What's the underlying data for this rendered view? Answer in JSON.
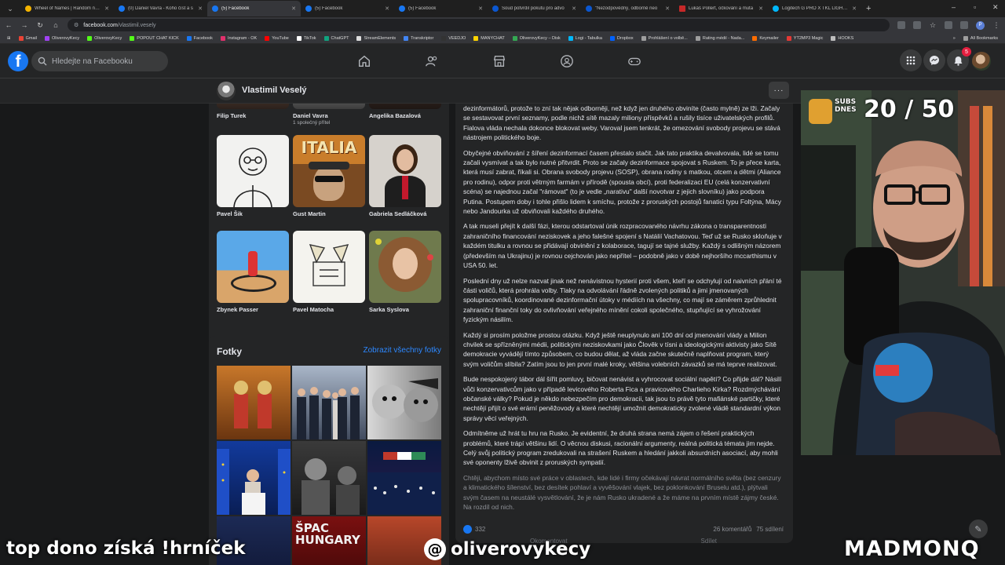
{
  "browser": {
    "tabs": [
      {
        "title": "Wheel of Names | Random nam",
        "active": false
      },
      {
        "title": "(0) Daniel Vavra - Koho číst a s",
        "active": false
      },
      {
        "title": "(5) Facebook",
        "active": true
      },
      {
        "title": "(5) Facebook",
        "active": false
      },
      {
        "title": "(5) Facebook",
        "active": false
      },
      {
        "title": "Soud potvrdil pokutu pro advo",
        "active": false
      },
      {
        "title": "\"Nezodpovědný, odborně neo",
        "active": false
      },
      {
        "title": "Lukáš Pollert, očkování a muta",
        "active": false
      },
      {
        "title": "Logitech G PRO X TKL LIGHTSP",
        "active": false
      }
    ],
    "url_host": "facebook.com",
    "url_path": "/vlastimil.vesely",
    "bookmarks": [
      "Gmail",
      "OliverovyKecy",
      "OliverovyKecy",
      "POPOUT CHAT KICK",
      "Facebook",
      "Instagram - OK",
      "YouTube",
      "TikTok",
      "ChatGPT",
      "StreamElements",
      "Transkriptor",
      "VEEDJO",
      "MANYCHAT",
      "OliverovyKecy – Disk",
      "Logi - Tabulka",
      "Dropbox",
      "Prohlášení o volbě...",
      "Rating médií - Nada...",
      "Keymailer",
      "YT2MP3 Magic",
      "HOOKS"
    ],
    "all_bookmarks": "All Bookmarks",
    "profile_initial": "P"
  },
  "facebook": {
    "search_placeholder": "Hledejte na Facebooku",
    "notification_count": "5",
    "profile_name": "Vlastimil Veselý",
    "more": "···"
  },
  "friends": [
    {
      "name": "Filip Turek",
      "sub": ""
    },
    {
      "name": "Daniel Vavra",
      "sub": "1 společný přítel"
    },
    {
      "name": "Angelika Bazalová",
      "sub": ""
    },
    {
      "name": "Pavel Šik",
      "sub": ""
    },
    {
      "name": "Gust Martin",
      "sub": ""
    },
    {
      "name": "Gabriela Sedláčková",
      "sub": ""
    },
    {
      "name": "Zbynek Passer",
      "sub": ""
    },
    {
      "name": "Pavel Matocha",
      "sub": ""
    },
    {
      "name": "Sarka Syslova",
      "sub": ""
    }
  ],
  "friend_photo_texts": {
    "italia": "ITALIA"
  },
  "photos": {
    "title": "Fotky",
    "link": "Zobrazit všechny fotky",
    "tile_text": "ŠPAC HUNGARY"
  },
  "post": {
    "paragraphs": [
      "dezinformátorů, protože to zní tak nějak odborněji, než když jen druhého obviníte (často mylně) ze lži. Začaly se sestavovat první seznamy, podle nichž sítě mazaly miliony příspěvků a rušily tisíce uživatelských profilů. Fialova vláda nechala dokonce blokovat weby. Varoval jsem tenkrát, že omezování svobody projevu se stává nástrojem politického boje.",
      "Obyčejné obviňování z šíření dezinformací časem přestalo stačit. Jak tato praktika devalvovala, lidé se tomu začali vysmívat a tak bylo nutné přitvrdit. Proto se začaly dezinformace spojovat s Ruskem. To je přece karta, která musí zabrat, říkali si. Obrana svobody projevu (SOSP), obrana rodiny s matkou, otcem a dětmi (Aliance pro rodinu), odpor proti větrným farmám v přírodě (spousta obcí), proti federalizaci EU (celá konzervativní scéna) se najednou začal \"rámovat\" (to je vedle „narativu\" další novotvar z jejich slovníku) jako podpora Putina. Postupem doby i tohle přišlo lidem k smíchu, protože z proruských postojů fanatici typu Foltýna, Mácy nebo Jandourka už obviňovali každého druhého.",
      "A tak museli přejít k další fázi, kterou odstartoval únik rozpracovaného návrhu zákona o transparentnosti zahraničního financování neziskovek a jeho falešné spojení s Natálií Vachatovou. Teď už se Rusko skloňuje v každém titulku a rovnou se přidávají obvinění z kolaborace, tagují se tajné služby. Každý s odlišným názorem (především na Ukrajinu) je rovnou cejchován jako nepřítel – podobně jako v době nejhoršího mccarthismu v USA 50. let.",
      "Poslední dny už nelze nazvat jinak než nenávistnou hysterií proti všem, kteří se odchylují od naivních přání té části voličů, která prohrála volby. Tlaky na odvolávání řádně zvolených politiků a jimi jmenovaných spolupracovníků, koordinované dezinformační útoky v médiích na všechny, co mají se záměrem zprůhlednit zahraniční finanční toky do ovlivňování veřejného mínění cokoli společného, stupňující se vyhrožování fyzickým násilím.",
      "Každý si prosím položme prostou otázku. Když ještě neuplynulo ani 100 dní od jmenování vlády a Milion chvilek se spřízněnými médii, politickými neziskovkami jako Člověk v tísni a ideologickými aktivisty jako Sítě demokracie vyvádějí tímto způsobem, co budou dělat, až vláda začne skutečně naplňovat program, který svým voličům slíbila? Zatím jsou to jen první malé kroky, většina volebních závazků se má teprve realizovat.",
      "Bude nespokojený tábor dál šířit pomluvy, bičovat nenávist a vyhrocovat sociální napětí? Co přijde dál? Násilí vůči konzervativcům jako v případě levicového Roberta Fica a pravicového Charlieho Kirka? Rozdmýchávání občanské války? Pokud je někdo nebezpečím pro demokracii, tak jsou to právě tyto mafiánské partičky, které nechtějí přijít o své erární peněžovody a které nechtějí umožnit demokraticky zvolené vládě standardní výkon správy věcí veřejných.",
      "Odmítněme už hrát tu hru na Rusko. Je evidentní, že druhá strana nemá zájem o řešení praktických problémů, které trápí většinu lidí. O věcnou diskusi, racionální argumenty, reálná politická témata jim nejde. Celý svůj politický program zredukovali na strašení Ruskem a hledání jakkoli absurdních asociací, aby mohli své oponenty lživě obvinit z proruských sympatií.",
      "Chtěji, abychom místo své práce v oblastech, kde lidé i firmy očekávají návrat normálního světa (bez cenzury a klimatického šílenství, bez desítek pohlaví a vyvěšování vlajek, bez poklonkování Bruselu atd.), plýtvali svým časem na neustálé vysvětlování, že je nám Rusko ukradené a že máme na prvním místě zájmy české. Na rozdíl od nich."
    ],
    "reactions": "332",
    "comments": "26 komentářů",
    "shares": "75 sdílení",
    "comment_btn": "Okomentovat",
    "share_btn": "Sdílet"
  },
  "stream": {
    "subs_label_line1": "SUBS",
    "subs_label_line2": "DNES",
    "subs_count": "20 / 50",
    "ticker": "top dono získá !hrníček",
    "handle": "oliverovykecy",
    "sponsor": "MADMONQ"
  },
  "colors": {
    "fb_blue": "#1877f2",
    "fb_dark": "#242526",
    "fb_bg": "#18191a",
    "link": "#2d88ff"
  },
  "icons": [
    "search-icon",
    "home-icon",
    "friends-icon",
    "marketplace-icon",
    "groups-icon",
    "gaming-icon",
    "menu-grid-icon",
    "messenger-icon",
    "bell-icon",
    "threads-icon",
    "edit-icon"
  ]
}
